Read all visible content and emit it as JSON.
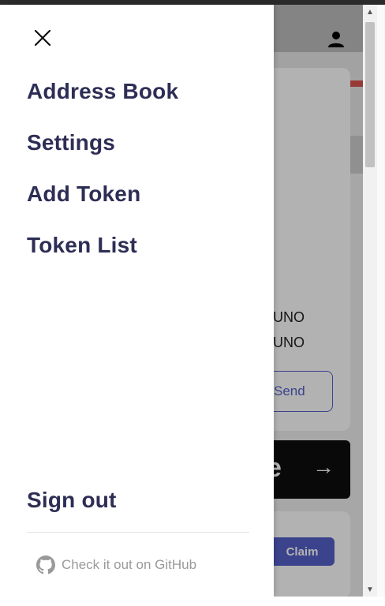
{
  "drawer": {
    "menu_items": [
      {
        "label": "Address Book"
      },
      {
        "label": "Settings"
      },
      {
        "label": "Add Token"
      },
      {
        "label": "Token List"
      }
    ],
    "sign_out_label": "Sign out",
    "github_link_label": "Check it out on GitHub"
  },
  "background": {
    "balance_1": "UNO",
    "balance_2": "UNO",
    "send_label": "Send",
    "banner_text": "e",
    "banner_arrow": "→",
    "claim_label": "Claim"
  },
  "icons": {
    "close": "close-icon",
    "user": "user-icon",
    "github": "github-icon"
  },
  "colors": {
    "nav_text": "#2d2e55",
    "accent": "#5560c9",
    "muted": "#9a9a9a",
    "alert": "#d9534f"
  }
}
